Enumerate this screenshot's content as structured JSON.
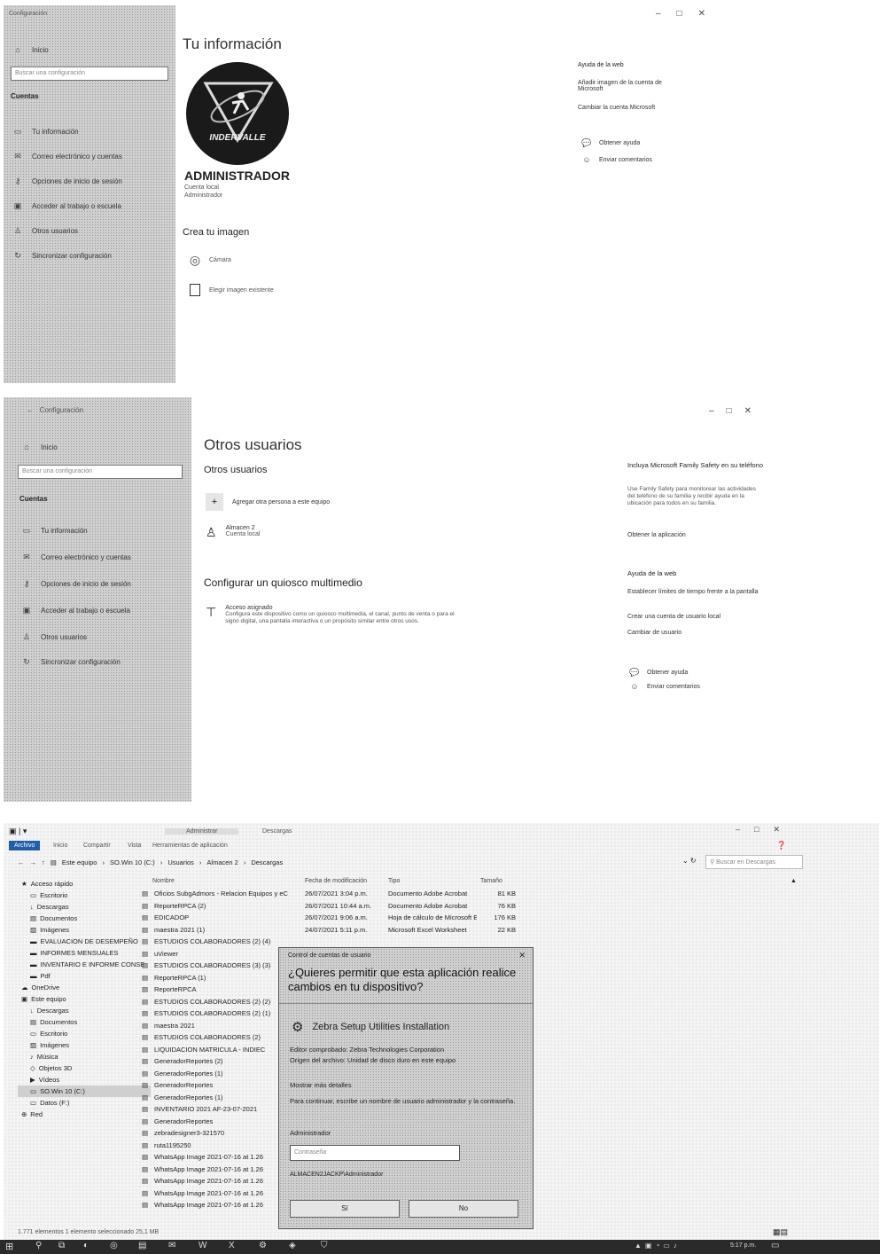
{
  "s1": {
    "window_title": "Configuración",
    "home": "Inicio",
    "search_placeholder": "Buscar una configuración",
    "section": "Cuentas",
    "nav": [
      "Tu información",
      "Correo electrónico y cuentas",
      "Opciones de inicio de sesión",
      "Acceder al trabajo o escuela",
      "Otros usuarios",
      "Sincronizar configuración"
    ],
    "page_title": "Tu información",
    "logo_text": "INDERVALLE",
    "user_name": "ADMINISTRADOR",
    "user_sub1": "Cuenta local",
    "user_sub2": "Administrador",
    "create_image": "Crea tu imagen",
    "camera": "Cámara",
    "choose_image": "Elegir imagen existente",
    "web_help": "Ayuda de la web",
    "help_link1": "Añadir imagen de la cuenta de Microsoft",
    "help_link2": "Cambiar la cuenta Microsoft",
    "get_help": "Obtener ayuda",
    "feedback": "Enviar comentarios"
  },
  "s2": {
    "window_title": "Configuración",
    "home": "Inicio",
    "search_placeholder": "Buscar una configuración",
    "section": "Cuentas",
    "nav": [
      "Tu información",
      "Correo electrónico y cuentas",
      "Opciones de inicio de sesión",
      "Acceder al trabajo o escuela",
      "Otros usuarios",
      "Sincronizar configuración"
    ],
    "page_title": "Otros usuarios",
    "subtitle": "Otros usuarios",
    "add_user": "Agregar otra persona a este equipo",
    "user1_name": "Almacen 2",
    "user1_sub": "Cuenta local",
    "kiosk_title": "Configurar un quiosco multimedio",
    "kiosk_item": "Acceso asignado",
    "kiosk_desc": "Configura este dispositivo como un quiosco multimedia, el canal, punto de venta o para el signo digital, una pantalla interactiva o un propósito similar entre otros usos.",
    "family_title": "Incluya Microsoft Family Safety en su teléfono",
    "family_desc": "Use Family Safety para monitorear las actividades del teléfono de su familia y recibir ayuda en la ubicación para todos en su familia.",
    "family_link": "Obtener la aplicación",
    "web_help": "Ayuda de la web",
    "help_link1": "Establecer límites de tiempo frente a la pantalla",
    "help_link2": "Crear una cuenta de usuario local",
    "help_link3": "Cambiar de usuario",
    "get_help": "Obtener ayuda",
    "feedback": "Enviar comentarios"
  },
  "explorer": {
    "tab_active": "Archivo",
    "ribbon": [
      "Inicio",
      "Compartir",
      "Vista",
      "Herramientas de aplicación"
    ],
    "ribbon_context_title": "Administrar",
    "window_caption": "Descargas",
    "path": [
      "Este equipo",
      "SO.Win 10 (C:)",
      "Usuarios",
      "Almacen 2",
      "Descargas"
    ],
    "search_placeholder": "Buscar en Descargas",
    "col_headers": [
      "Nombre",
      "Fecha de modificación",
      "Tipo",
      "Tamaño"
    ],
    "left_nav": [
      "Acceso rápido",
      "Escritorio",
      "Descargas",
      "Documentos",
      "Imágenes",
      "EVALUACION DE DESEMPEÑO",
      "INFORMES MENSUALES",
      "INVENTARIO E INFORME CONSE",
      "Pdf",
      "OneDrive",
      "Este equipo",
      "Descargas",
      "Documentos",
      "Escritorio",
      "Imágenes",
      "Música",
      "Objetos 3D",
      "Vídeos",
      "SO.Win 10 (C:)",
      "Datos (F:)",
      "Red"
    ],
    "files": [
      {
        "name": "Oficios SubgAdmors - Relacion Equipos y eC",
        "date": "26/07/2021 3:04 p.m.",
        "type": "Documento Adobe Acrobat",
        "size": "81 KB"
      },
      {
        "name": "ReporteRPCA (2)",
        "date": "26/07/2021 10:44 a.m.",
        "type": "Documento Adobe Acrobat",
        "size": "76 KB"
      },
      {
        "name": "EDICADOP",
        "date": "26/07/2021 9:06 a.m.",
        "type": "Hoja de cálculo de Microsoft Excel",
        "size": "176 KB"
      },
      {
        "name": "maestra 2021 (1)",
        "date": "24/07/2021 5:11 p.m.",
        "type": "Microsoft Excel Worksheet",
        "size": "22 KB"
      },
      {
        "name": "ESTUDIOS COLABORADORES (2) (4)",
        "date": "",
        "type": "",
        "size": ""
      },
      {
        "name": "uViewer",
        "date": "",
        "type": "",
        "size": ""
      },
      {
        "name": "ESTUDIOS COLABORADORES (3) (3)",
        "date": "",
        "type": "",
        "size": ""
      },
      {
        "name": "ReporteRPCA (1)",
        "date": "",
        "type": "",
        "size": ""
      },
      {
        "name": "ReporteRPCA",
        "date": "",
        "type": "",
        "size": ""
      },
      {
        "name": "ESTUDIOS COLABORADORES (2) (2)",
        "date": "",
        "type": "",
        "size": ""
      },
      {
        "name": "ESTUDIOS COLABORADORES (2) (1)",
        "date": "",
        "type": "",
        "size": ""
      },
      {
        "name": "maestra 2021",
        "date": "",
        "type": "",
        "size": ""
      },
      {
        "name": "ESTUDIOS COLABORADORES (2)",
        "date": "",
        "type": "",
        "size": ""
      },
      {
        "name": "LIQUIDACION MATRICULA - INDIEC",
        "date": "",
        "type": "",
        "size": ""
      },
      {
        "name": "GeneradorReportes (2)",
        "date": "",
        "type": "",
        "size": ""
      },
      {
        "name": "GeneradorReportes (1)",
        "date": "",
        "type": "",
        "size": ""
      },
      {
        "name": "GeneradorReportes",
        "date": "",
        "type": "",
        "size": ""
      },
      {
        "name": "GeneradorReportes (1)",
        "date": "",
        "type": "",
        "size": ""
      },
      {
        "name": "INVENTARIO 2021 AF-23-07-2021",
        "date": "",
        "type": "",
        "size": ""
      },
      {
        "name": "GeneradorReportes",
        "date": "",
        "type": "",
        "size": ""
      },
      {
        "name": "zebradesigner3-321570",
        "date": "",
        "type": "",
        "size": ""
      },
      {
        "name": "ruta1195250",
        "date": "",
        "type": "",
        "size": ""
      },
      {
        "name": "WhatsApp Image 2021-07-16 at 1.26",
        "date": "",
        "type": "",
        "size": ""
      },
      {
        "name": "WhatsApp Image 2021-07-16 at 1.26",
        "date": "",
        "type": "",
        "size": ""
      },
      {
        "name": "WhatsApp Image 2021-07-16 at 1.26",
        "date": "",
        "type": "",
        "size": ""
      },
      {
        "name": "WhatsApp Image 2021-07-16 at 1.26",
        "date": "",
        "type": "",
        "size": ""
      },
      {
        "name": "WhatsApp Image 2021-07-16 at 1.26",
        "date": "",
        "type": "",
        "size": ""
      }
    ],
    "status": "1.771 elementos    1 elemento seleccionado  25,1 MB"
  },
  "uac": {
    "title": "Control de cuentas de usuario",
    "question": "¿Quieres permitir que esta aplicación realice cambios en tu dispositivo?",
    "app_name": "Zebra Setup Utilities Installation",
    "publisher": "Editor comprobado: Zebra Technologies Corporation",
    "origin": "Origen del archivo: Unidad de disco duro en este equipo",
    "more_details": "Mostrar más detalles",
    "instruction": "Para continuar, escribe un nombre de usuario administrador y la contraseña.",
    "user_label": "Administrador",
    "password_placeholder": "Contraseña",
    "domain": "ALMACEN2JACKP\\Administrador",
    "yes": "Sí",
    "no": "No"
  },
  "taskbar": {
    "time": "5:17 p.m."
  }
}
